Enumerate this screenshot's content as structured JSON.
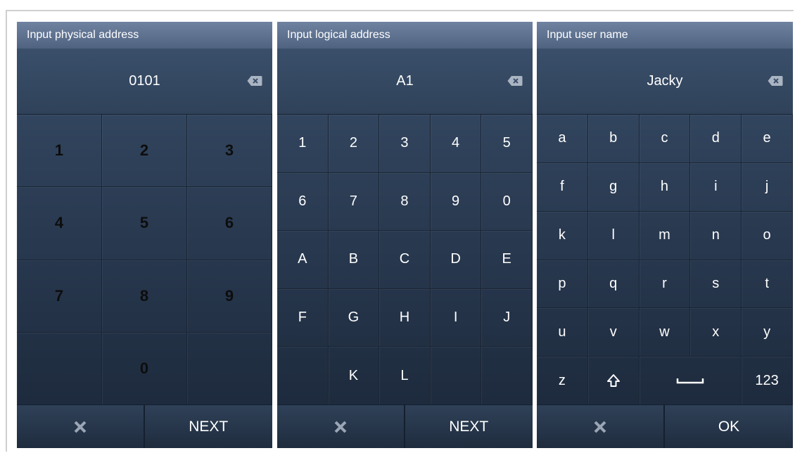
{
  "colors": {
    "panel_top": "#394e69",
    "panel_bottom": "#1b2739",
    "titlebar": "#5a6e8c"
  },
  "panels": [
    {
      "title": "Input physical address",
      "value": "0101",
      "keys": [
        "1",
        "2",
        "3",
        "4",
        "5",
        "6",
        "7",
        "8",
        "9",
        "",
        "0",
        ""
      ],
      "cancel_icon": "x-icon",
      "confirm_label": "NEXT"
    },
    {
      "title": "Input logical address",
      "value": "A1",
      "keys": [
        "1",
        "2",
        "3",
        "4",
        "5",
        "6",
        "7",
        "8",
        "9",
        "0",
        "A",
        "B",
        "C",
        "D",
        "E",
        "F",
        "G",
        "H",
        "I",
        "J",
        "",
        "K",
        "L",
        "",
        ""
      ],
      "cancel_icon": "x-icon",
      "confirm_label": "NEXT"
    },
    {
      "title": "Input user name",
      "value": "Jacky",
      "keys": [
        "a",
        "b",
        "c",
        "d",
        "e",
        "f",
        "g",
        "h",
        "i",
        "j",
        "k",
        "l",
        "m",
        "n",
        "o",
        "p",
        "q",
        "r",
        "s",
        "t",
        "u",
        "v",
        "w",
        "x",
        "y",
        "z"
      ],
      "special_keys": {
        "shift_icon": "shift-arrow-icon",
        "space_icon": "space-bar-icon",
        "mode_label": "123"
      },
      "cancel_icon": "x-icon",
      "confirm_label": "OK"
    }
  ]
}
